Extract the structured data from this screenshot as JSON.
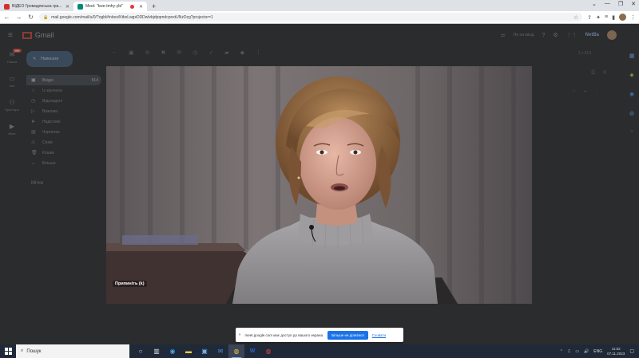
{
  "browser": {
    "tabs": [
      {
        "title": "ВІДЕО Громадянська гра...",
        "active": false
      },
      {
        "title": "Meet: \"kwe-tmhy-ybi\"",
        "active": true,
        "recording": true
      }
    ],
    "url": "mail.google.com/mail/u/0/?ogbl#inbox/KtbxLwgxDDDwlvbjdpqmdcpnxtUNzDzg?projector=1"
  },
  "gmail": {
    "app_name": "Gmail",
    "compose_label": "Написати",
    "inbox_count": "914",
    "mail_badge": "99+",
    "folders": [
      {
        "icon": "inbox-icon",
        "label": "Вхідні",
        "count": "914"
      },
      {
        "icon": "star-icon",
        "label": "Із зірочкою",
        "count": ""
      },
      {
        "icon": "clock-icon",
        "label": "Відкладені",
        "count": ""
      },
      {
        "icon": "important-icon",
        "label": "Важливі",
        "count": ""
      },
      {
        "icon": "send-icon",
        "label": "Надіслані",
        "count": ""
      },
      {
        "icon": "draft-icon",
        "label": "Чернетки",
        "count": ""
      },
      {
        "icon": "spam-icon",
        "label": "Спам",
        "count": ""
      },
      {
        "icon": "trash-icon",
        "label": "Кошик",
        "count": ""
      },
      {
        "icon": "chevron-down-icon",
        "label": "Більше",
        "count": ""
      }
    ],
    "labels_title": "Мітки",
    "rail": [
      {
        "label": "Пошта",
        "icon": "mail-icon"
      },
      {
        "label": "Чат",
        "icon": "chat-icon"
      },
      {
        "label": "Простори",
        "icon": "spaces-icon"
      },
      {
        "label": "Meet",
        "icon": "video-icon"
      }
    ],
    "status": "Не на місці",
    "brand": "NetBa",
    "pager": "1 з 914"
  },
  "video": {
    "caption": "Припиніть (k)"
  },
  "sharebar": {
    "message": "meet.google.com має доступ до вашого екрана.",
    "stop_label": "Більше не ділитися",
    "hide_label": "Сховати"
  },
  "taskbar": {
    "search_placeholder": "Пошук",
    "language": "ENG",
    "time": "11:52",
    "date": "07.11.2023"
  }
}
